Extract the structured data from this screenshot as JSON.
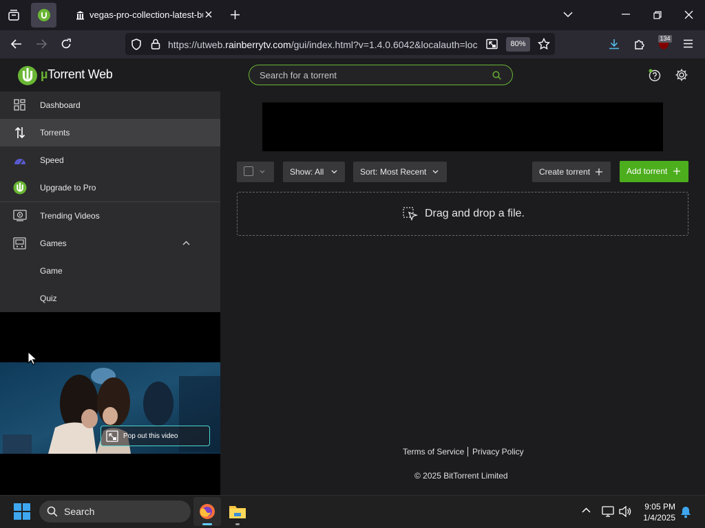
{
  "browser": {
    "tab_title": "vegas-pro-collection-latest-bui",
    "url_prefix": "https://utweb.",
    "url_domain": "rainberrytv.com",
    "url_rest": "/gui/index.html?v=1.4.0.6042&localauth=loc",
    "zoom": "80%",
    "extension_badge": "134"
  },
  "app": {
    "logo_mu": "µ",
    "logo_name": "Torrent Web",
    "search_placeholder": "Search for a torrent"
  },
  "sidebar": {
    "items": [
      {
        "label": "Dashboard",
        "icon": "dashboard-icon"
      },
      {
        "label": "Torrents",
        "icon": "transfer-arrows-icon",
        "active": true
      },
      {
        "label": "Speed",
        "icon": "speedometer-icon"
      },
      {
        "label": "Upgrade to Pro",
        "icon": "utorrent-logo-icon"
      },
      {
        "label": "Trending Videos",
        "icon": "video-play-icon"
      },
      {
        "label": "Games",
        "icon": "arcade-icon",
        "expanded": true
      },
      {
        "label": "Game"
      },
      {
        "label": "Quiz"
      }
    ]
  },
  "video": {
    "popout_label": "Pop out this video"
  },
  "toolbar": {
    "show_label": "Show:",
    "show_value": "All",
    "sort_label": "Sort:",
    "sort_value": "Most Recent",
    "create_label": "Create torrent",
    "add_label": "Add torrent"
  },
  "dropzone": {
    "text": "Drag and drop a file."
  },
  "footer": {
    "terms": "Terms of Service",
    "privacy": "Privacy Policy",
    "copyright": "© 2025 BitTorrent Limited"
  },
  "taskbar": {
    "search_label": "Search",
    "time": "9:05 PM",
    "date": "1/4/2025"
  },
  "colors": {
    "accent": "#6ab634",
    "add_button": "#4dae1d",
    "active_tab": "#42414d"
  }
}
